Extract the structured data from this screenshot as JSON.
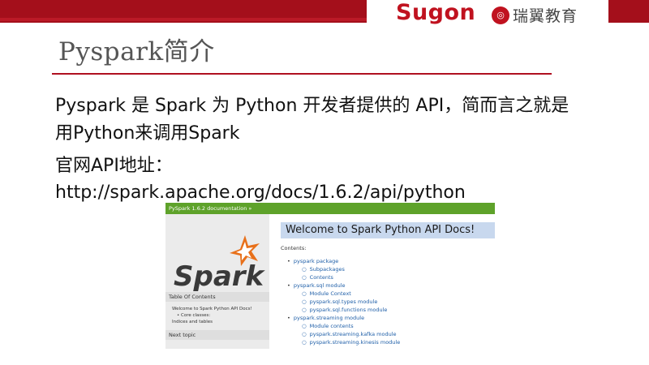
{
  "header": {
    "brand_logo": "Sugon",
    "partner_logo_text": "瑞翼教育",
    "partner_logo_icon": "ruiyi-logo-icon",
    "accent_color": "#a40f1b"
  },
  "slide": {
    "title": "Pyspark简介",
    "lines": [
      "Pyspark 是 Spark 为 Python 开发者提供的 API，简而言之就是",
      "用Python来调用Spark",
      "官网API地址：",
      "http://spark.apache.org/docs/1.6.2/api/python"
    ]
  },
  "docs_screenshot": {
    "header_text": "PySpark 1.6.2 documentation »",
    "logo": "Spark",
    "sidebar": {
      "toc_heading": "Table Of Contents",
      "toc_items": [
        "Welcome to Spark Python API Docs!",
        "Core classes:",
        "Indices and tables"
      ],
      "next_heading": "Next topic"
    },
    "welcome_title": "Welcome to Spark Python API Docs!",
    "contents_label": "Contents:",
    "contents": [
      {
        "label": "pyspark package",
        "level": 1
      },
      {
        "label": "Subpackages",
        "level": 2
      },
      {
        "label": "Contents",
        "level": 2
      },
      {
        "label": "pyspark.sql module",
        "level": 1
      },
      {
        "label": "Module Context",
        "level": 2
      },
      {
        "label": "pyspark.sql.types module",
        "level": 2
      },
      {
        "label": "pyspark.sql.functions module",
        "level": 2
      },
      {
        "label": "pyspark.streaming module",
        "level": 1
      },
      {
        "label": "Module contents",
        "level": 2
      },
      {
        "label": "pyspark.streaming.kafka module",
        "level": 2
      },
      {
        "label": "pyspark.streaming.kinesis module",
        "level": 2
      }
    ]
  }
}
